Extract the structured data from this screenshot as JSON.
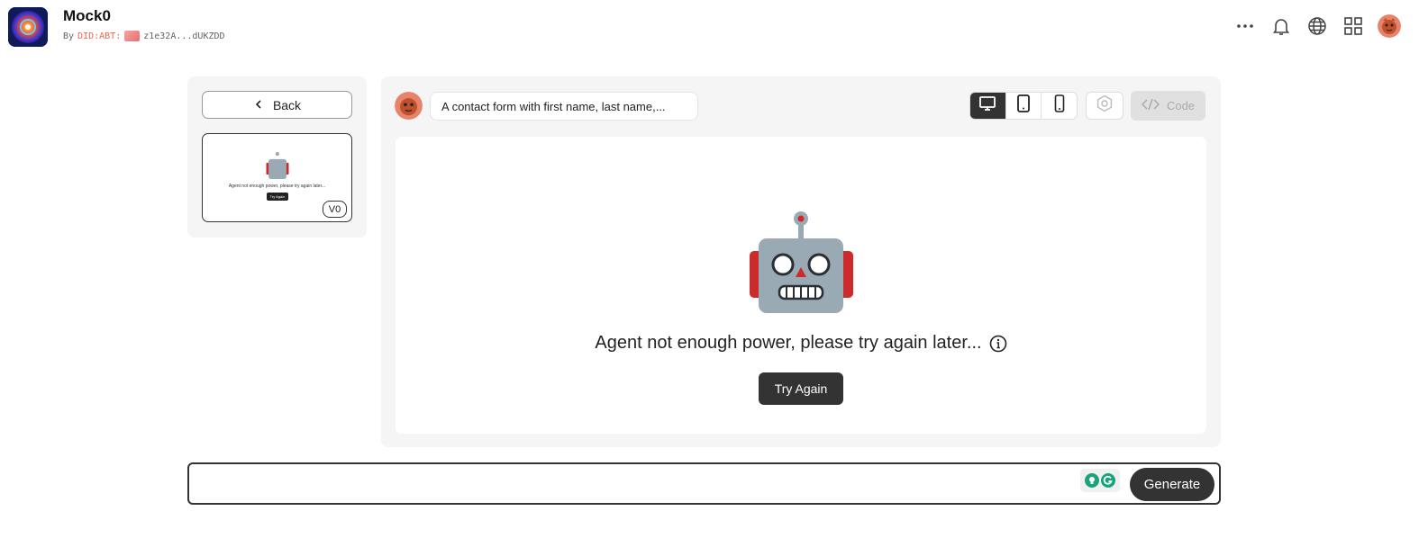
{
  "app": {
    "title": "Mock0",
    "by_label": "By",
    "did_prefix": "DID:ABT:",
    "did_value": "z1e32A...dUKZDD"
  },
  "header_icons": [
    "more-icon",
    "bell-icon",
    "globe-icon",
    "apps-grid-icon",
    "user-avatar"
  ],
  "sidebar": {
    "back_label": "Back",
    "versions": [
      {
        "label": "V0",
        "preview_text": "Agent not enough power, please try again later...",
        "preview_button": "Try Again"
      }
    ]
  },
  "toolbar": {
    "prompt_text": "A contact form with first name, last name,...",
    "devices": [
      "desktop",
      "tablet",
      "mobile"
    ],
    "active_device": "desktop",
    "code_label": "Code"
  },
  "preview": {
    "error_message": "Agent not enough power, please try again later...",
    "try_again_label": "Try Again"
  },
  "composer": {
    "input_value": "",
    "input_placeholder": "",
    "generate_label": "Generate"
  },
  "colors": {
    "dark_button": "#333333",
    "panel_bg": "#f5f5f5",
    "did_accent": "#e26a4a",
    "robot_body": "#99aab5",
    "robot_ears": "#cc2b2b"
  }
}
